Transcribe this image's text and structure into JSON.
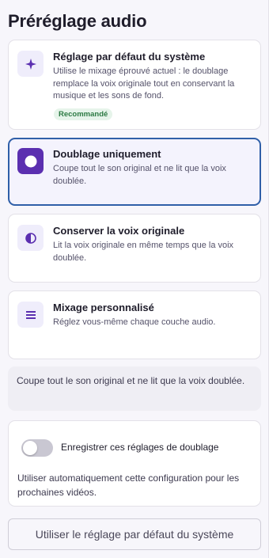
{
  "page": {
    "title": "Préréglage audio"
  },
  "options": [
    {
      "title": "Réglage par défaut du système",
      "description": "Utilise le mixage éprouvé actuel : le doublage remplace la voix originale tout en conservant la musique et les sons de fond.",
      "badge": "Recommandé",
      "icon": "sparkle-icon",
      "selected": false
    },
    {
      "title": "Doublage uniquement",
      "description": "Coupe tout le son original et ne lit que la voix doublée.",
      "icon": "circle-icon",
      "selected": true
    },
    {
      "title": "Conserver la voix originale",
      "description": "Lit la voix originale en même temps que la voix doublée.",
      "icon": "half-circle-icon",
      "selected": false
    },
    {
      "title": "Mixage personnalisé",
      "description": "Réglez vous-même chaque couche audio.",
      "icon": "sliders-icon",
      "selected": false
    }
  ],
  "info": {
    "text": "Coupe tout le son original et ne lit que la voix doublée."
  },
  "settings": {
    "toggle_label": "Enregistrer ces réglages de doublage",
    "toggle_on": false,
    "note": "Utiliser automatiquement cette configuration pour les prochaines vidéos."
  },
  "footer": {
    "reset_label": "Utiliser le réglage par défaut du système"
  },
  "colors": {
    "accent": "#5b2fb0",
    "selected_border": "#2f5fa8",
    "badge_bg": "#e6f4ea",
    "badge_text": "#2c7a43"
  }
}
